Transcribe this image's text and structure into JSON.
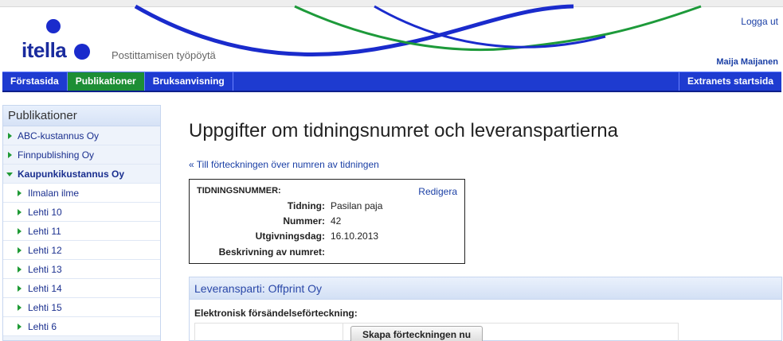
{
  "header": {
    "logo_text": "itella",
    "tagline": "Postittamisen työpöytä",
    "logout_label": "Logga ut",
    "username": "Maija Maijanen"
  },
  "nav": {
    "items": [
      {
        "label": "Förstasida",
        "active": false
      },
      {
        "label": "Publikationer",
        "active": true
      },
      {
        "label": "Bruksanvisning",
        "active": false
      }
    ],
    "right_label": "Extranets startsida"
  },
  "sidebar": {
    "title": "Publikationer",
    "items": [
      {
        "label": "ABC-kustannus Oy",
        "level": 0,
        "expanded": false
      },
      {
        "label": "Finnpublishing Oy",
        "level": 0,
        "expanded": false
      },
      {
        "label": "Kaupunkikustannus Oy",
        "level": 0,
        "expanded": true
      },
      {
        "label": "Ilmalan ilme",
        "level": 1
      },
      {
        "label": "Lehti 10",
        "level": 1
      },
      {
        "label": "Lehti 11",
        "level": 1
      },
      {
        "label": "Lehti 12",
        "level": 1
      },
      {
        "label": "Lehti 13",
        "level": 1
      },
      {
        "label": "Lehti 14",
        "level": 1
      },
      {
        "label": "Lehti 15",
        "level": 1
      },
      {
        "label": "Lehti 6",
        "level": 1
      }
    ]
  },
  "main": {
    "title": "Uppgifter om tidningsnumret och leveranspartierna",
    "back_link": "« Till förteckningen över numren av tidningen",
    "issue_box": {
      "heading": "TIDNINGSNUMMER:",
      "edit_label": "Redigera",
      "rows": [
        {
          "label": "Tidning:",
          "value": "Pasilan paja"
        },
        {
          "label": "Nummer:",
          "value": "42"
        },
        {
          "label": "Utgivningsdag:",
          "value": "16.10.2013"
        },
        {
          "label": "Beskrivning av numret:",
          "value": ""
        }
      ]
    },
    "delivery": {
      "heading": "Leveransparti: Offprint Oy",
      "subheading": "Elektronisk försändelseförteckning:",
      "button_label": "Skapa förteckningen nu"
    }
  },
  "colors": {
    "brand_blue": "#1a2bcc",
    "nav_blue": "#1e3bd0",
    "nav_active_green": "#1d8e35",
    "link_blue": "#1a3fa5"
  }
}
